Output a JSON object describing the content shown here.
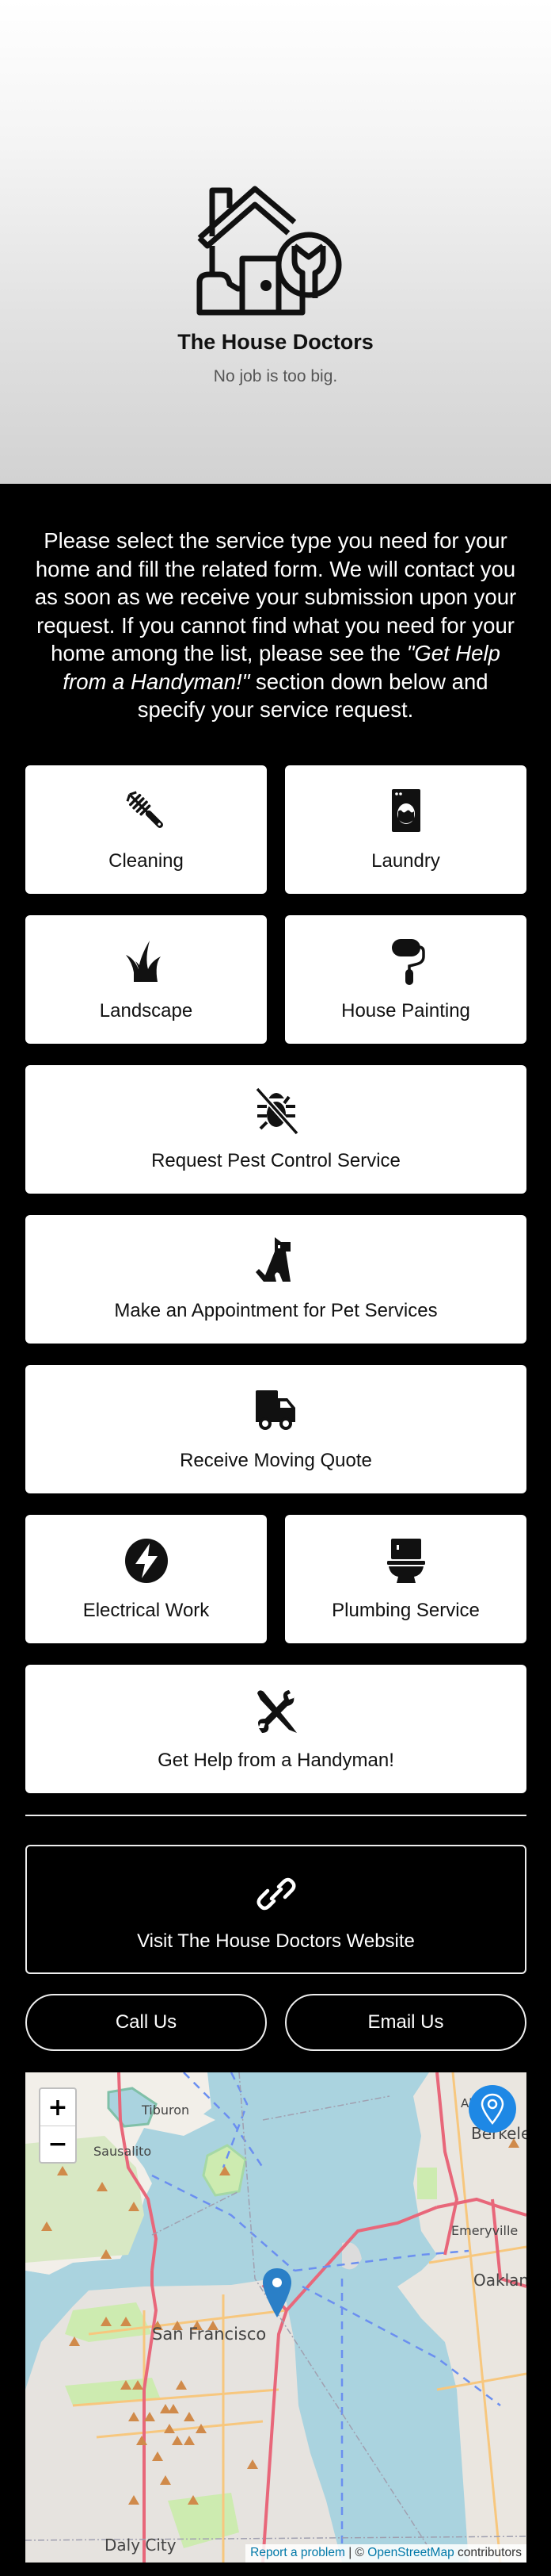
{
  "hero": {
    "title": "The House Doctors",
    "tagline": "No job is too big.",
    "logo_icon": "house-wrench-icon"
  },
  "intro": {
    "text_before": "Please select the service type you need for your home and fill the related form. We will contact you as soon as we receive your submission upon your request. If you cannot find what you need for your home among the list, please see the ",
    "emphasis": "\"Get Help from a Handyman!\"",
    "text_after": " section down below and specify your service request."
  },
  "services": [
    {
      "label": "Cleaning",
      "icon": "brush-icon"
    },
    {
      "label": "Laundry",
      "icon": "washing-machine-icon"
    },
    {
      "label": "Landscape",
      "icon": "grass-icon"
    },
    {
      "label": "House Painting",
      "icon": "paint-roller-icon"
    },
    {
      "label": "Request Pest Control Service",
      "icon": "pest-control-icon"
    },
    {
      "label": "Make an Appointment for Pet Services",
      "icon": "dog-icon"
    },
    {
      "label": "Receive Moving Quote",
      "icon": "truck-icon"
    },
    {
      "label": "Electrical Work",
      "icon": "bolt-icon"
    },
    {
      "label": "Plumbing Service",
      "icon": "toilet-icon"
    },
    {
      "label": "Get Help from a Handyman!",
      "icon": "tools-icon"
    }
  ],
  "website": {
    "label": "Visit The House Doctors Website",
    "icon": "link-icon"
  },
  "contact": {
    "call_label": "Call Us",
    "email_label": "Email Us"
  },
  "map": {
    "zoom_in": "+",
    "zoom_out": "−",
    "places": [
      "Tiburon",
      "Sausalito",
      "Albany",
      "Berkeley",
      "Emeryville",
      "Oakland",
      "San Francisco",
      "Daly City"
    ],
    "attribution": {
      "report": "Report a problem",
      "separator": " | © ",
      "osm": "OpenStreetMap",
      "suffix": " contributors"
    },
    "colors": {
      "water": "#aad3df",
      "land": "#f2efe9",
      "park": "#cdebb0",
      "road_major": "#e8677a",
      "road_minor": "#f7c77e",
      "pin": "#2a7fc7",
      "locate": "#1e88e5"
    }
  }
}
